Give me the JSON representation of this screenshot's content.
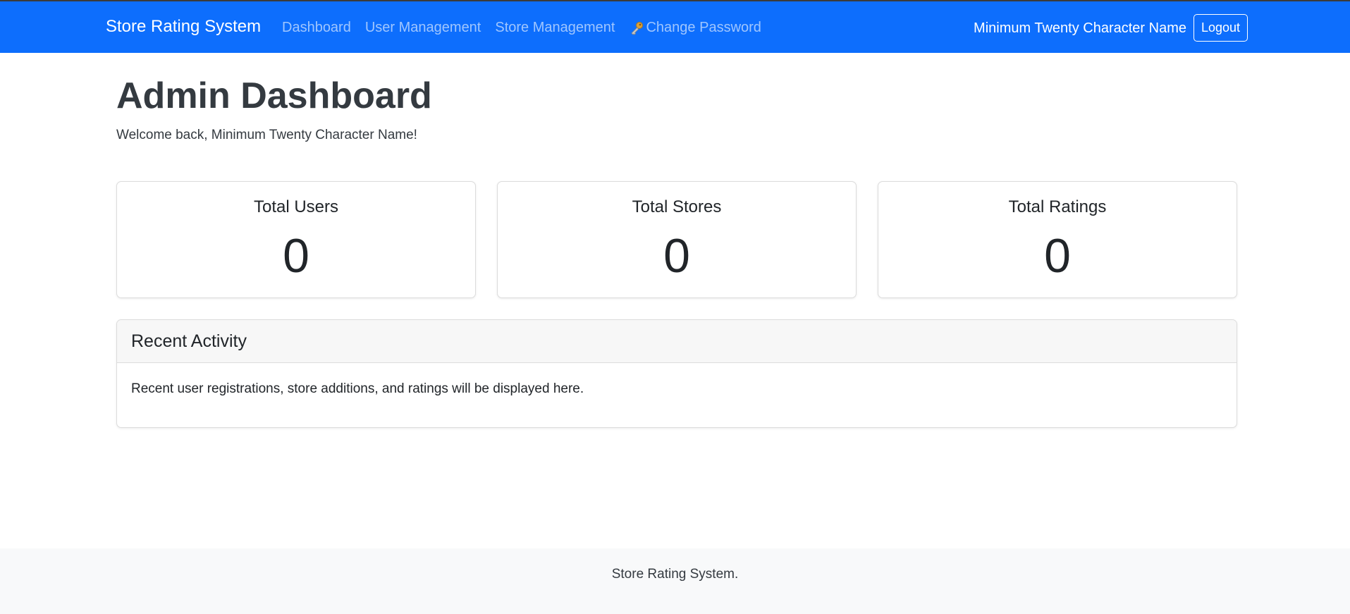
{
  "navbar": {
    "brand": "Store Rating System",
    "links": [
      {
        "label": "Dashboard"
      },
      {
        "label": "User Management"
      },
      {
        "label": "Store Management"
      },
      {
        "label": "Change Password",
        "icon": "key-icon"
      }
    ],
    "user_name": "Minimum Twenty Character Name",
    "logout_label": "Logout"
  },
  "main": {
    "title": "Admin Dashboard",
    "welcome": "Welcome back, Minimum Twenty Character Name!",
    "stats": [
      {
        "title": "Total Users",
        "value": "0"
      },
      {
        "title": "Total Stores",
        "value": "0"
      },
      {
        "title": "Total Ratings",
        "value": "0"
      }
    ],
    "activity": {
      "title": "Recent Activity",
      "body": "Recent user registrations, store additions, and ratings will be displayed here."
    }
  },
  "footer": {
    "text": "Store Rating System."
  },
  "colors": {
    "navbar_bg": "#0d6efd",
    "footer_bg": "#f8f9fa"
  }
}
